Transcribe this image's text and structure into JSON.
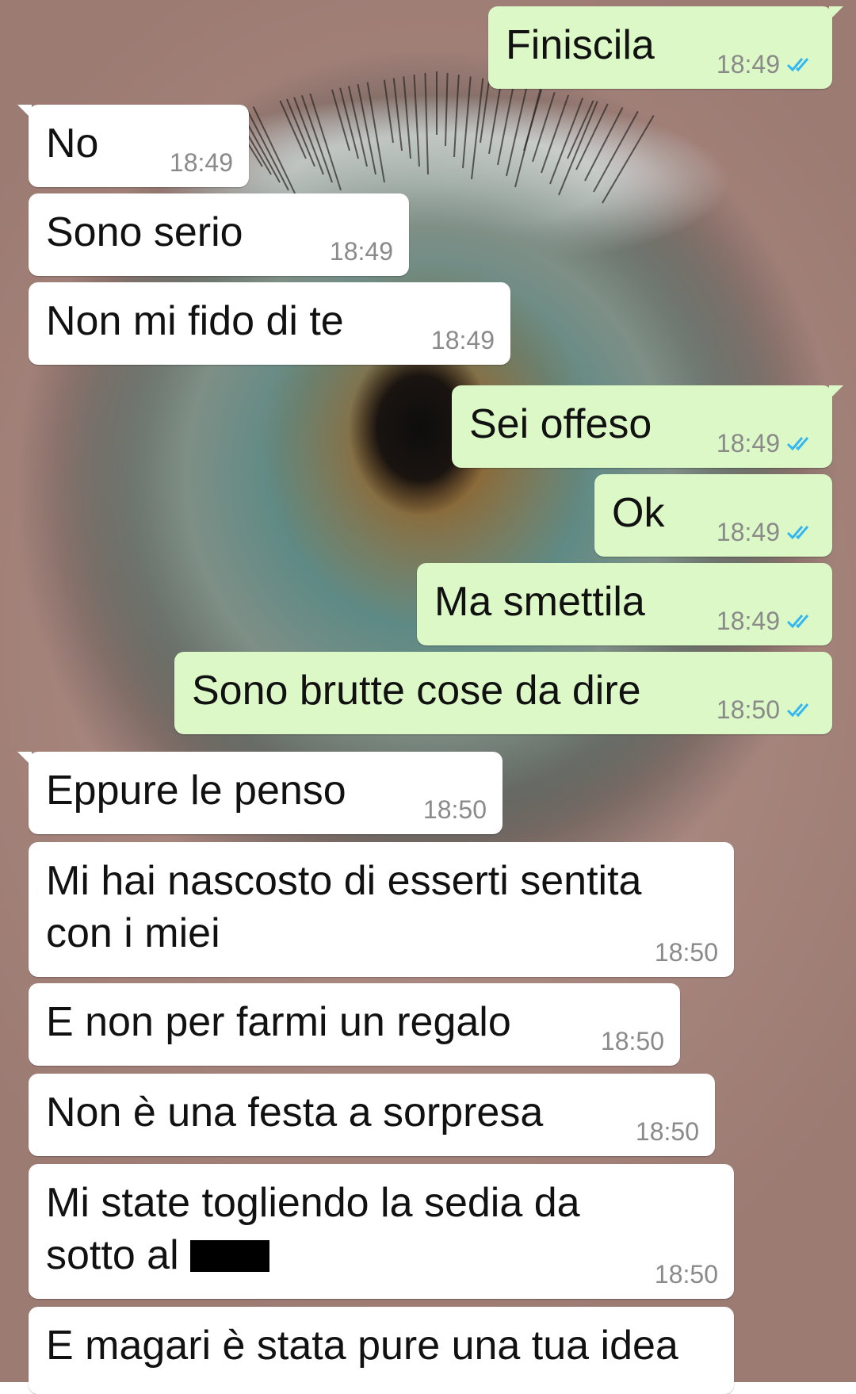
{
  "theme": {
    "incoming_bubble": "#ffffff",
    "outgoing_bubble": "#dcf8c6",
    "read_tick": "#34b7f1",
    "time_text": "#8a8a8a"
  },
  "messages": [
    {
      "dir": "out",
      "text": "Finiscila",
      "time": "18:49",
      "status": "read"
    },
    {
      "dir": "in",
      "text": "No",
      "time": "18:49"
    },
    {
      "dir": "in",
      "text": "Sono serio",
      "time": "18:49"
    },
    {
      "dir": "in",
      "text": "Non mi fido di te",
      "time": "18:49"
    },
    {
      "dir": "out",
      "text": "Sei offeso",
      "time": "18:49",
      "status": "read"
    },
    {
      "dir": "out",
      "text": "Ok",
      "time": "18:49",
      "status": "read"
    },
    {
      "dir": "out",
      "text": "Ma smettila",
      "time": "18:49",
      "status": "read"
    },
    {
      "dir": "out",
      "text": "Sono brutte cose da dire",
      "time": "18:50",
      "status": "read"
    },
    {
      "dir": "in",
      "text": "Eppure le penso",
      "time": "18:50"
    },
    {
      "dir": "in",
      "text_line1": "Mi hai nascosto di esserti sentita",
      "text_line2": "con i miei",
      "time": "18:50"
    },
    {
      "dir": "in",
      "text": "E non per farmi un regalo",
      "time": "18:50"
    },
    {
      "dir": "in",
      "text": "Non è una festa a sorpresa",
      "time": "18:50"
    },
    {
      "dir": "in",
      "text_line1": "Mi state togliendo la sedia da",
      "text_line2": "sotto al",
      "redacted": true,
      "time": "18:50"
    },
    {
      "dir": "in",
      "text": "E magari è stata pure una tua idea"
    }
  ]
}
